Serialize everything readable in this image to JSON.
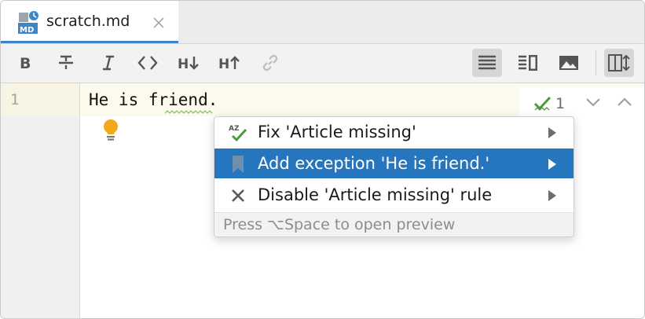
{
  "tab": {
    "icon": "markdown-file-icon",
    "title": "scratch.md",
    "close_icon": "close-icon"
  },
  "toolbar": {
    "buttons": [
      {
        "name": "bold",
        "icon": "bold-icon",
        "glyph": "B"
      },
      {
        "name": "strikethrough",
        "icon": "strikethrough-icon",
        "glyph": "S"
      },
      {
        "name": "italic",
        "icon": "italic-icon",
        "glyph": "I"
      },
      {
        "name": "code",
        "icon": "code-icon",
        "glyph": "<>"
      },
      {
        "name": "header-down",
        "icon": "header-decrease-icon",
        "glyph": "H↓"
      },
      {
        "name": "header-up",
        "icon": "header-increase-icon",
        "glyph": "H↑"
      },
      {
        "name": "link",
        "icon": "link-icon",
        "glyph": "link"
      }
    ],
    "view_modes": [
      "editor-only-icon",
      "editor-and-preview-icon",
      "preview-only-icon"
    ],
    "sync_scroll_icon": "sync-scroll-icon"
  },
  "editor": {
    "line_number": "1",
    "line_text": "He is friend.",
    "bulb_icon": "lightbulb-icon"
  },
  "inspection_widget": {
    "count": "1",
    "check_icon": "check-icon",
    "next_icon": "chevron-down-icon",
    "prev_icon": "chevron-up-icon"
  },
  "popup": {
    "items": [
      {
        "label": "Fix 'Article missing'",
        "icon": "spellcheck-icon",
        "selected": false
      },
      {
        "label": "Add exception 'He is friend.'",
        "icon": "bookmark-icon",
        "selected": true
      },
      {
        "label": "Disable 'Article missing' rule",
        "icon": "close-icon",
        "selected": false
      }
    ],
    "footer": "Press ⌥Space to open preview"
  },
  "colors": {
    "selection": "#2675bf",
    "tab_underline": "#4083c9",
    "bulb": "#f3a81c",
    "check": "#4b9a3b"
  }
}
